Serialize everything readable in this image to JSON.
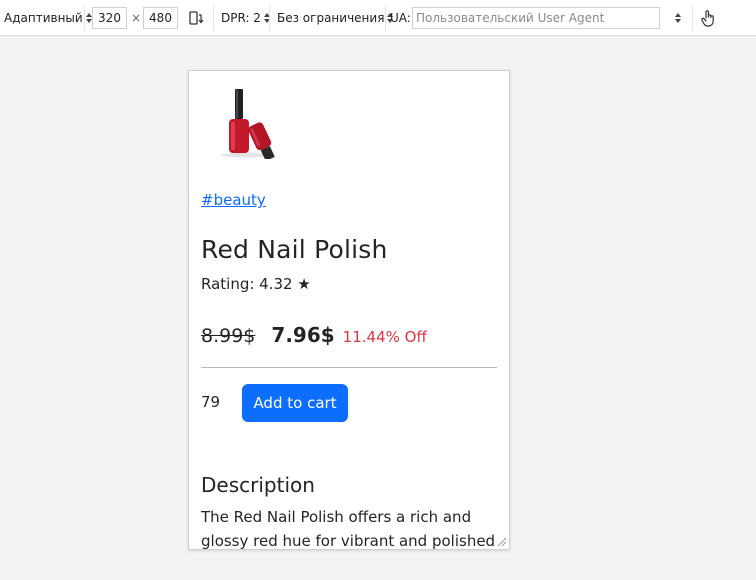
{
  "toolbar": {
    "device_mode": "Адаптивный",
    "width": "320",
    "times": "×",
    "height": "480",
    "dpr_label": "DPR: 2",
    "throttling": "Без ограничения",
    "ua_label": "UA:",
    "ua_placeholder": "Пользовательский User Agent"
  },
  "product": {
    "image_icon": "nail-polish-image",
    "tag": "#beauty",
    "title": "Red Nail Polish",
    "rating": "Rating: 4.32 ★",
    "old_price": "8.99$",
    "new_price": "7.96$",
    "discount": "11.44% Off",
    "quantity": "79",
    "cart_button": "Add to cart",
    "description_heading": "Description",
    "description_text": "The Red Nail Polish offers a rich and glossy red hue for vibrant and polished"
  },
  "colors": {
    "link": "#0d6efd",
    "button": "#0d6efd",
    "discount": "#dc3545",
    "polish_red": "#c4182b"
  }
}
